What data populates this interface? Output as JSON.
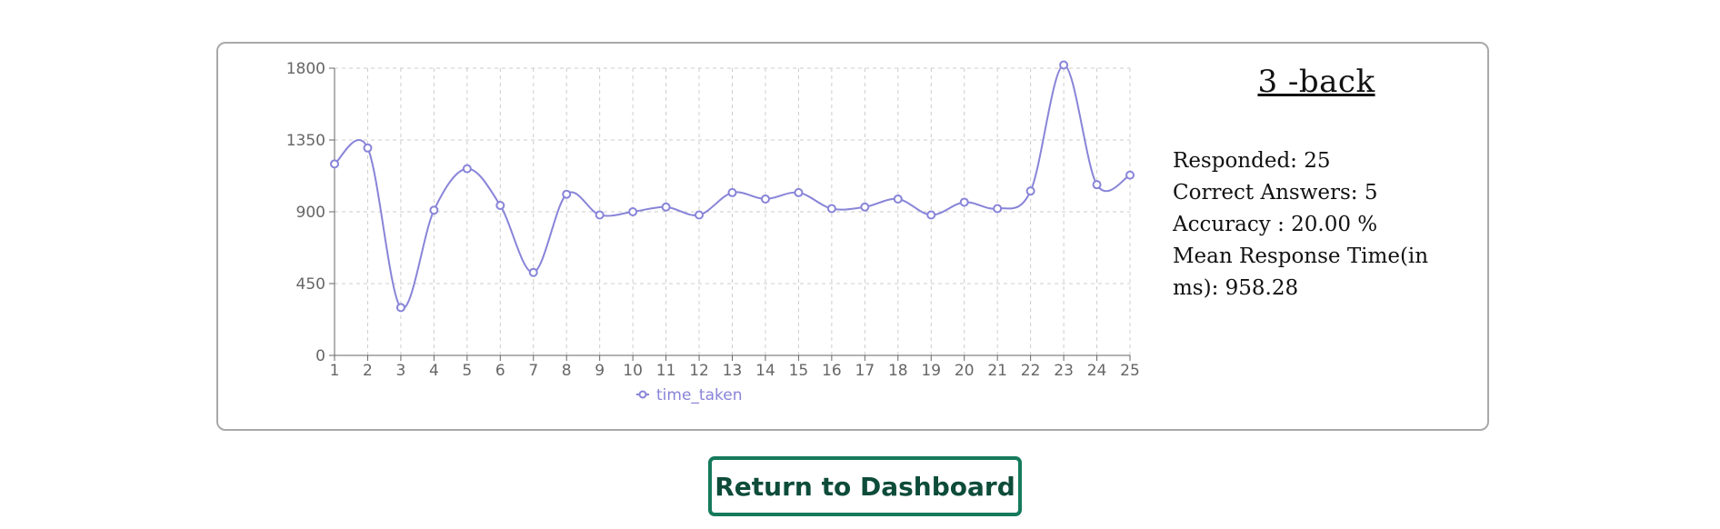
{
  "panel": {
    "title": "3 -back",
    "stats": [
      {
        "label": "Responded:",
        "value": "25"
      },
      {
        "label": "Correct Answers:",
        "value": "5"
      },
      {
        "label": "Accuracy :",
        "value": "20.00 %"
      },
      {
        "label": "Mean Response Time(in ms):",
        "value": "958.28"
      }
    ]
  },
  "button": {
    "label": "Return to Dashboard"
  },
  "colors": {
    "line": "#8884d8",
    "grid": "#cccccc",
    "axis": "#666666",
    "button_border": "#157a5c",
    "button_text": "#0e4c3a"
  },
  "chart_data": {
    "type": "line",
    "categories": [
      "1",
      "2",
      "3",
      "4",
      "5",
      "6",
      "7",
      "8",
      "9",
      "10",
      "11",
      "12",
      "13",
      "14",
      "15",
      "16",
      "17",
      "18",
      "19",
      "20",
      "21",
      "22",
      "23",
      "24",
      "25"
    ],
    "series": [
      {
        "name": "time_taken",
        "values": [
          1200,
          1300,
          300,
          910,
          1170,
          940,
          520,
          1010,
          880,
          900,
          930,
          880,
          1020,
          980,
          1020,
          920,
          930,
          980,
          880,
          960,
          920,
          1030,
          1820,
          1070,
          1130
        ]
      }
    ],
    "yticks": [
      0,
      450,
      900,
      1350,
      1800
    ],
    "ylim": [
      0,
      1800
    ],
    "grid": true,
    "legend": "bottom"
  }
}
